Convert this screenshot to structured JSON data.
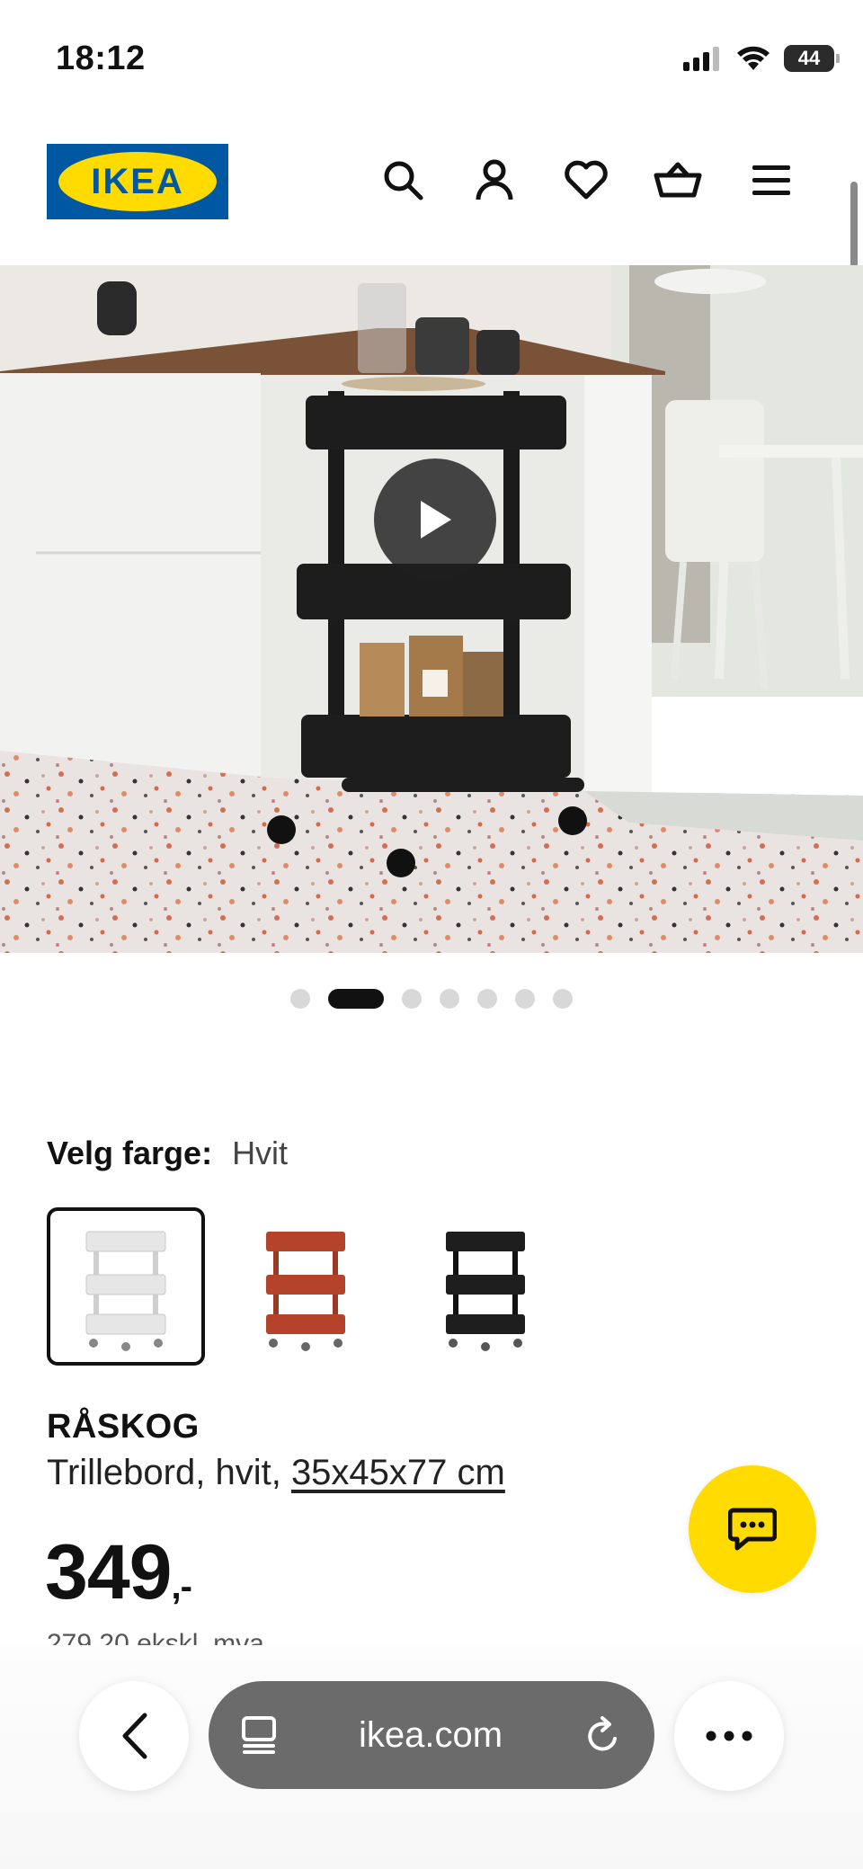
{
  "status_bar": {
    "time": "18:12",
    "battery": "44"
  },
  "header": {
    "logo_text": "IKEA",
    "icons": [
      "search-icon",
      "account-icon",
      "heart-icon",
      "basket-icon",
      "menu-icon"
    ]
  },
  "gallery": {
    "slide_count": 7,
    "active_index": 1
  },
  "color_picker": {
    "label": "Velg farge:",
    "selected": "Hvit",
    "swatches": [
      {
        "name": "Hvit",
        "color": "#e9e9e9"
      },
      {
        "name": "Rød",
        "color": "#b5432b"
      },
      {
        "name": "Svart",
        "color": "#1e1e1e"
      }
    ]
  },
  "product": {
    "name": "RÅSKOG",
    "description_prefix": "Trillebord, hvit, ",
    "size": "35x45x77 cm",
    "price": "349",
    "price_suffix": ",-",
    "price_excl_vat": "279,20 ekskl. mva."
  },
  "browser": {
    "url": "ikea.com"
  },
  "colors": {
    "brand_blue": "#0058a3",
    "brand_yellow": "#ffdb00"
  }
}
